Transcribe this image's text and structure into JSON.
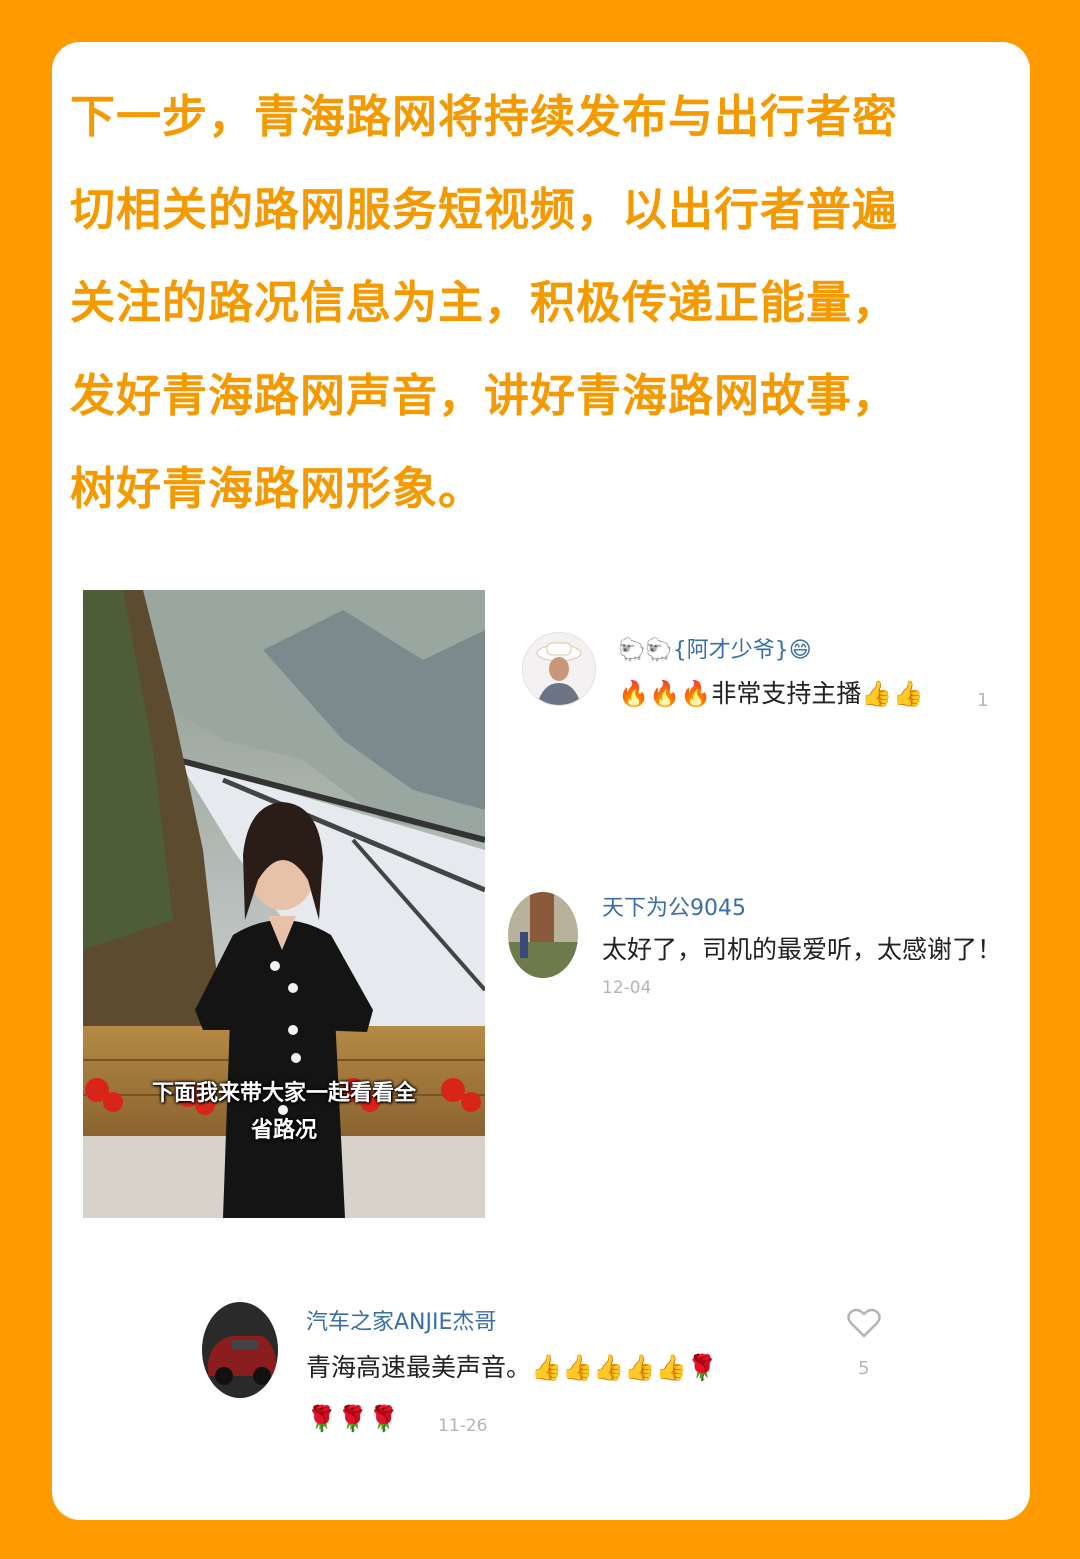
{
  "headline": {
    "lines": [
      "下一步，青海路网将持续发布与出行者密",
      "切相关的路网服务短视频，以出行者普遍",
      "关注的路况信息为主，积极传递正能量，",
      "发好青海路网声音，讲好青海路网故事，",
      "树好青海路网形象。"
    ]
  },
  "video": {
    "subtitle_line1": "下面我来带大家一起看看全",
    "subtitle_line2": "省路况"
  },
  "comments": [
    {
      "user": "🐑🐑{阿才少爷}😄",
      "prefix": "🔥🔥🔥",
      "text": "非常支持主播👍👍",
      "likes": "1"
    },
    {
      "user": "天下为公9045",
      "text": "太好了，司机的最爱听，太感谢了！",
      "date": "12-04"
    },
    {
      "user": "汽车之家ANJIE杰哥",
      "text": "青海高速最美声音。👍👍👍👍👍🌹",
      "text2": "🌹🌹🌹",
      "date": "11-26",
      "likes": "5"
    }
  ],
  "colors": {
    "background": "#FF9A00",
    "headline": "#F49A00",
    "username": "#3A6EA5"
  }
}
